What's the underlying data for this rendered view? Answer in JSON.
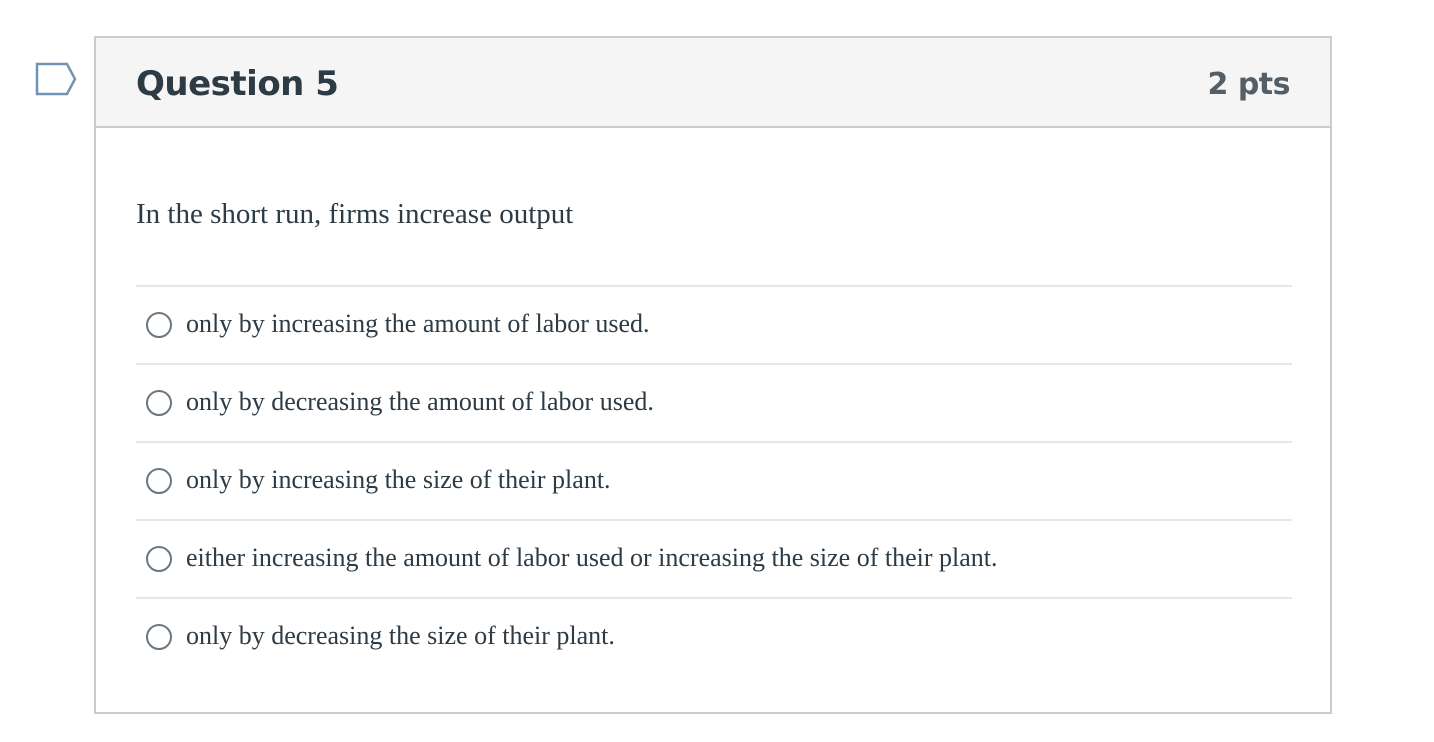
{
  "question": {
    "title": "Question 5",
    "points": "2 pts",
    "text": "In the short run, firms increase output",
    "flag_icon": "flag-icon"
  },
  "answers": [
    {
      "label": "only by increasing the amount of labor used.",
      "selected": false
    },
    {
      "label": "only by decreasing the amount of labor used.",
      "selected": false
    },
    {
      "label": "only by increasing the size of their plant.",
      "selected": false
    },
    {
      "label": "either increasing the amount of labor used or increasing the size of their plant.",
      "selected": false
    },
    {
      "label": "only by decreasing the size of their plant.",
      "selected": false
    }
  ],
  "colors": {
    "text": "#2d3b45",
    "points": "#545e66",
    "header_bg": "#f5f5f5",
    "border": "#c7cdd1",
    "flag_outline": "#7194b4"
  }
}
